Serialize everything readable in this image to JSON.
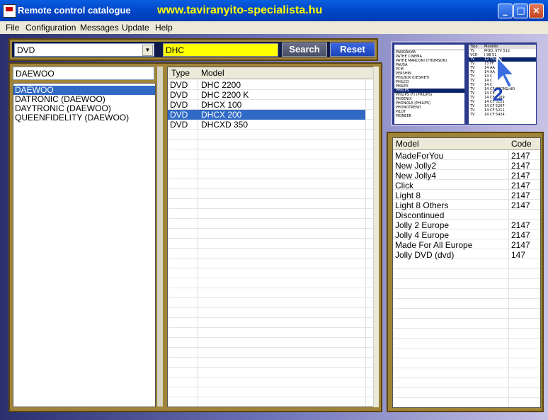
{
  "window": {
    "title": "Remote control catalogue",
    "url_banner": "www.taviranyito-specialista.hu",
    "controls": [
      "_",
      "□",
      "×"
    ]
  },
  "menu": [
    "File",
    "Configuration",
    "Messages",
    "Update",
    "Help"
  ],
  "device_select": {
    "value": "DVD"
  },
  "search": {
    "value": "DHC",
    "search_label": "Search",
    "reset_label": "Reset"
  },
  "brand_filter": {
    "value": "DAEWOO"
  },
  "brands": [
    "DAEWOO",
    "DATRONIC (DAEWOO)",
    "DAYTRONIC (DAEWOO)",
    "QUEENFIDELITY (DAEWOO)"
  ],
  "brands_selected": 0,
  "models_table": {
    "headers": [
      "Type",
      "Model"
    ],
    "rows": [
      {
        "type": "DVD",
        "model": "DHC 2200"
      },
      {
        "type": "DVD",
        "model": "DHC 2200 K"
      },
      {
        "type": "DVD",
        "model": "DHCX 100"
      },
      {
        "type": "DVD",
        "model": "DHCX 200"
      },
      {
        "type": "DVD",
        "model": "DHCXD 350"
      }
    ],
    "selected": 3
  },
  "preview": {
    "brands": [
      "PANORAMA",
      "PATHE CINEMA",
      "PATHE MARCONI (THOMSON)",
      "PAUSA",
      "PCM",
      "PERSHIN",
      "PHILBOX (DESMET)",
      "PHILCO",
      "PHILEX",
      "PHILIPS",
      "PHILIPS (F) (PHILIPS)",
      "PHOENIX",
      "PHONOLA (PHILIPS)",
      "PHONOTREND",
      "PILOT",
      "PIONEER"
    ],
    "headers": [
      "Tipo",
      "Modello"
    ],
    "rows": [
      [
        "TV",
        "MOD. STV 512"
      ],
      [
        "VCR",
        "I 98 51"
      ],
      [
        "TV",
        "12 TVL 12"
      ],
      [
        "TV",
        "13 FF"
      ],
      [
        "TV",
        "14 AA"
      ],
      [
        "TV",
        "14 AA"
      ],
      [
        "TV",
        "14 C"
      ],
      [
        "TV",
        "14 C"
      ],
      [
        "TV",
        "14 C"
      ],
      [
        "TV",
        "14 CF BRONZINO"
      ],
      [
        "TV",
        "14 CE"
      ],
      [
        "TV",
        "14 CF 5009"
      ],
      [
        "TV",
        "14 CF 5201"
      ],
      [
        "TV",
        "14 CF 5207"
      ],
      [
        "TV",
        "14 CF 5211"
      ],
      [
        "TV",
        "14 CF 5424"
      ]
    ],
    "badge": "2"
  },
  "codes_table": {
    "headers": [
      "Model",
      "Code"
    ],
    "rows": [
      {
        "model": "MadeForYou",
        "code": "2147"
      },
      {
        "model": "New Jolly2",
        "code": "2147"
      },
      {
        "model": "New Jolly4",
        "code": "2147"
      },
      {
        "model": "Click",
        "code": "2147"
      },
      {
        "model": "Light 8",
        "code": "2147"
      },
      {
        "model": "Light 8 Others",
        "code": "2147"
      },
      {
        "model": "Discontinued",
        "code": ""
      },
      {
        "model": "Jolly 2 Europe",
        "code": "2147"
      },
      {
        "model": "Jolly 4 Europe",
        "code": "2147"
      },
      {
        "model": "Made For All Europe",
        "code": "2147"
      },
      {
        "model": "Jolly DVD (dvd)",
        "code": "147"
      }
    ]
  },
  "colors": {
    "selection": "#316ac5",
    "search_bg": "#ffff00",
    "panel_gold": "#a08437",
    "url_yellow": "#ffff00"
  }
}
